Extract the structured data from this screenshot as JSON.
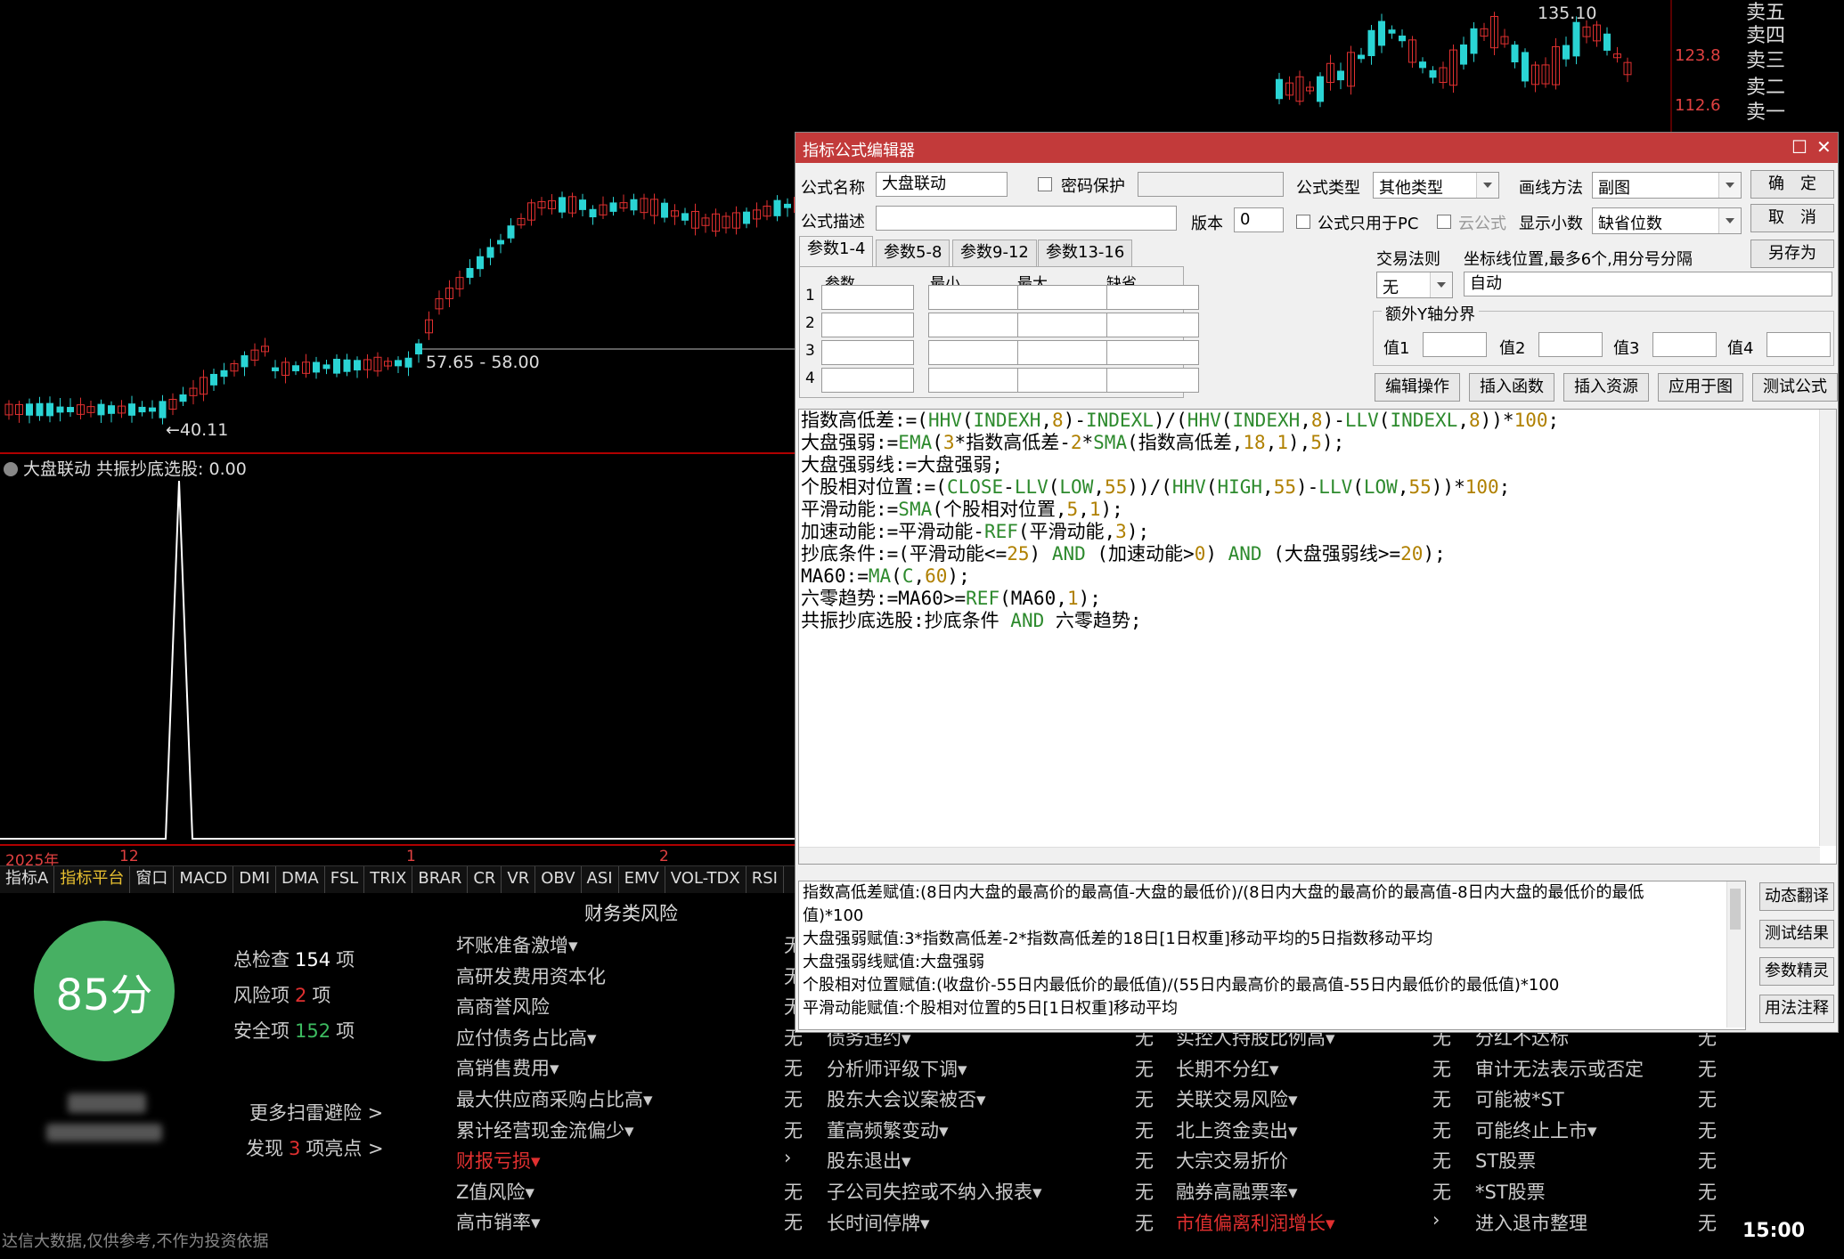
{
  "colors": {
    "up": "#e03030",
    "down": "#2ad4d4",
    "accent_red": "#b00000",
    "score_green": "#47b063",
    "dialog_title": "#c23a3a"
  },
  "main_chart": {
    "price_labels": {
      "high": "135.10",
      "low_range": "57.65 - 58.00",
      "low": "40.11"
    },
    "axis_labels": [
      "123.8",
      "112.6"
    ]
  },
  "sub_chart": {
    "title": "大盘联动 共振抄底选股: 0.00"
  },
  "time_axis": {
    "labels": [
      "2025年",
      "12",
      "1",
      "2"
    ]
  },
  "indicator_tabs": [
    "指标A",
    "指标平台",
    "窗口",
    "MACD",
    "DMI",
    "DMA",
    "FSL",
    "TRIX",
    "BRAR",
    "CR",
    "VR",
    "OBV",
    "ASI",
    "EMV",
    "VOL-TDX",
    "RSI"
  ],
  "sell_levels": [
    "卖五",
    "卖四",
    "卖三",
    "卖二",
    "卖一"
  ],
  "bottom_time": "15:00",
  "risk": {
    "score": "85分",
    "total_label": "总检查",
    "total_num": "154",
    "total_unit": "项",
    "risk_label": "风险项",
    "risk_num": "2",
    "risk_unit": "项",
    "safe_label": "安全项",
    "safe_num": "152",
    "safe_unit": "项",
    "more_link": "更多扫雷避险 >",
    "highlight_pre": "发现",
    "highlight_num": "3",
    "highlight_post": "项亮点 >",
    "section_title": "财务类风险",
    "col1": [
      "坏账准备激增▾",
      "高研发费用资本化",
      "高商誉风险",
      "应付债务占比高▾",
      "高销售费用▾",
      "最大供应商采购占比高▾",
      "累计经营现金流偏少▾",
      "财报亏损▾",
      "Z值风险▾",
      "高市销率▾"
    ],
    "col1_vals": [
      "无",
      "无",
      "无",
      "无",
      "无",
      "无",
      "无",
      "›",
      "无",
      "无"
    ],
    "col2": [
      "债务违约▾",
      "分析师评级下调▾",
      "股东大会议案被否▾",
      "董高频繁变动▾",
      "股东退出▾",
      "子公司失控或不纳入报表▾",
      "长时间停牌▾"
    ],
    "col2_vals": [
      "无",
      "无",
      "无",
      "无",
      "无",
      "无",
      "无"
    ],
    "col3": [
      "实控人持股比例高▾",
      "长期不分红▾",
      "关联交易风险▾",
      "北上资金卖出▾",
      "大宗交易折价",
      "融券高融票率▾",
      "市值偏离利润增长▾"
    ],
    "col3_vals": [
      "无",
      "无",
      "无",
      "无",
      "无",
      "无",
      "›"
    ],
    "col4": [
      "分红不达标",
      "审计无法表示或否定",
      "可能被*ST",
      "可能终止上市▾",
      "ST股票",
      "*ST股票",
      "进入退市整理"
    ],
    "col4_vals": [
      "无",
      "无",
      "无",
      "无",
      "无",
      "无",
      "无"
    ],
    "footer_note": "达信大数据,仅供参考,不作为投资依据"
  },
  "editor": {
    "title": "指标公式编辑器",
    "name_label": "公式名称",
    "name_value": "大盘联动",
    "password_label": "密码保护",
    "type_label": "公式类型",
    "type_value": "其他类型",
    "draw_label": "画线方法",
    "draw_value": "副图",
    "ok": "确　定",
    "cancel": "取　消",
    "save_as": "另存为",
    "desc_label": "公式描述",
    "version_label": "版本",
    "version_value": "0",
    "pc_only_label": "公式只用于PC",
    "cloud_label": "云公式",
    "decimal_label": "显示小数",
    "decimal_value": "缺省位数",
    "param_tabs": [
      "参数1-4",
      "参数5-8",
      "参数9-12",
      "参数13-16"
    ],
    "param_headers": [
      "参数",
      "最小",
      "最大",
      "缺省"
    ],
    "param_rows": [
      "1",
      "2",
      "3",
      "4"
    ],
    "trade_rule_label": "交易法则",
    "trade_rule_value": "无",
    "coord_label": "坐标线位置,最多6个,用分号分隔",
    "coord_value": "自动",
    "yaxis_label": "额外Y轴分界",
    "yaxis_vals": [
      "值1",
      "值2",
      "值3",
      "值4"
    ],
    "buttons": [
      "编辑操作",
      "插入函数",
      "插入资源",
      "应用于图",
      "测试公式"
    ],
    "side_buttons": [
      "动态翻译",
      "测试结果",
      "参数精灵",
      "用法注释"
    ],
    "translations": [
      "指数高低差赋值:(8日内大盘的最高价的最高值-大盘的最低价)/(8日内大盘的最高价的最高值-8日内大盘的最低价的最低",
      "值)*100",
      "大盘强弱赋值:3*指数高低差-2*指数高低差的18日[1日权重]移动平均的5日指数移动平均",
      "大盘强弱线赋值:大盘强弱",
      "个股相对位置赋值:(收盘价-55日内最低价的最低值)/(55日内最高价的最高值-55日内最低价的最低值)*100",
      "平滑动能赋值:个股相对位置的5日[1日权重]移动平均"
    ]
  }
}
